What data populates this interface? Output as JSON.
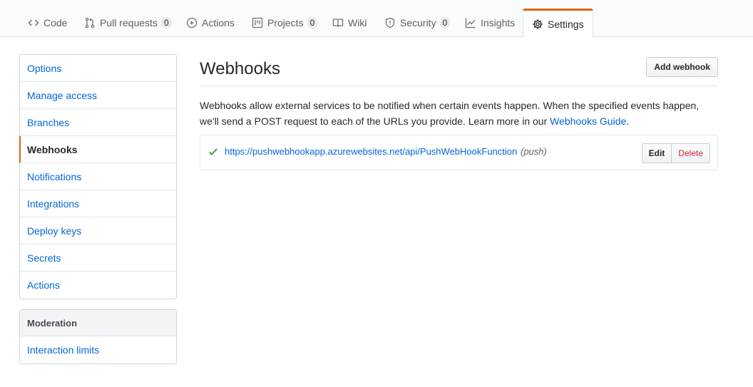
{
  "repo_nav": {
    "tabs": [
      {
        "label": "Code",
        "icon": "code-icon"
      },
      {
        "label": "Pull requests",
        "icon": "pull-request-icon",
        "count": "0"
      },
      {
        "label": "Actions",
        "icon": "play-icon"
      },
      {
        "label": "Projects",
        "icon": "project-icon",
        "count": "0"
      },
      {
        "label": "Wiki",
        "icon": "book-icon"
      },
      {
        "label": "Security",
        "icon": "shield-icon",
        "count": "0"
      },
      {
        "label": "Insights",
        "icon": "graph-icon"
      },
      {
        "label": "Settings",
        "icon": "gear-icon",
        "selected": true
      }
    ]
  },
  "sidebar": {
    "items": [
      {
        "label": "Options"
      },
      {
        "label": "Manage access"
      },
      {
        "label": "Branches"
      },
      {
        "label": "Webhooks",
        "selected": true
      },
      {
        "label": "Notifications"
      },
      {
        "label": "Integrations"
      },
      {
        "label": "Deploy keys"
      },
      {
        "label": "Secrets"
      },
      {
        "label": "Actions"
      }
    ],
    "moderation": {
      "heading": "Moderation",
      "items": [
        {
          "label": "Interaction limits"
        }
      ]
    }
  },
  "main": {
    "title": "Webhooks",
    "add_button": "Add webhook",
    "description_text": "Webhooks allow external services to be notified when certain events happen. When the specified events happen, we'll send a POST request to each of the URLs you provide. Learn more in our ",
    "description_link": "Webhooks Guide",
    "description_end": ".",
    "webhooks": [
      {
        "url": "https://pushwebhookapp.azurewebsites.net/api/PushWebHookFunction",
        "events": "(push)",
        "status": "success",
        "edit_label": "Edit",
        "delete_label": "Delete"
      }
    ]
  },
  "colors": {
    "accent": "#e36209",
    "link": "#0366d6",
    "success": "#28a745",
    "danger": "#cb2431"
  }
}
